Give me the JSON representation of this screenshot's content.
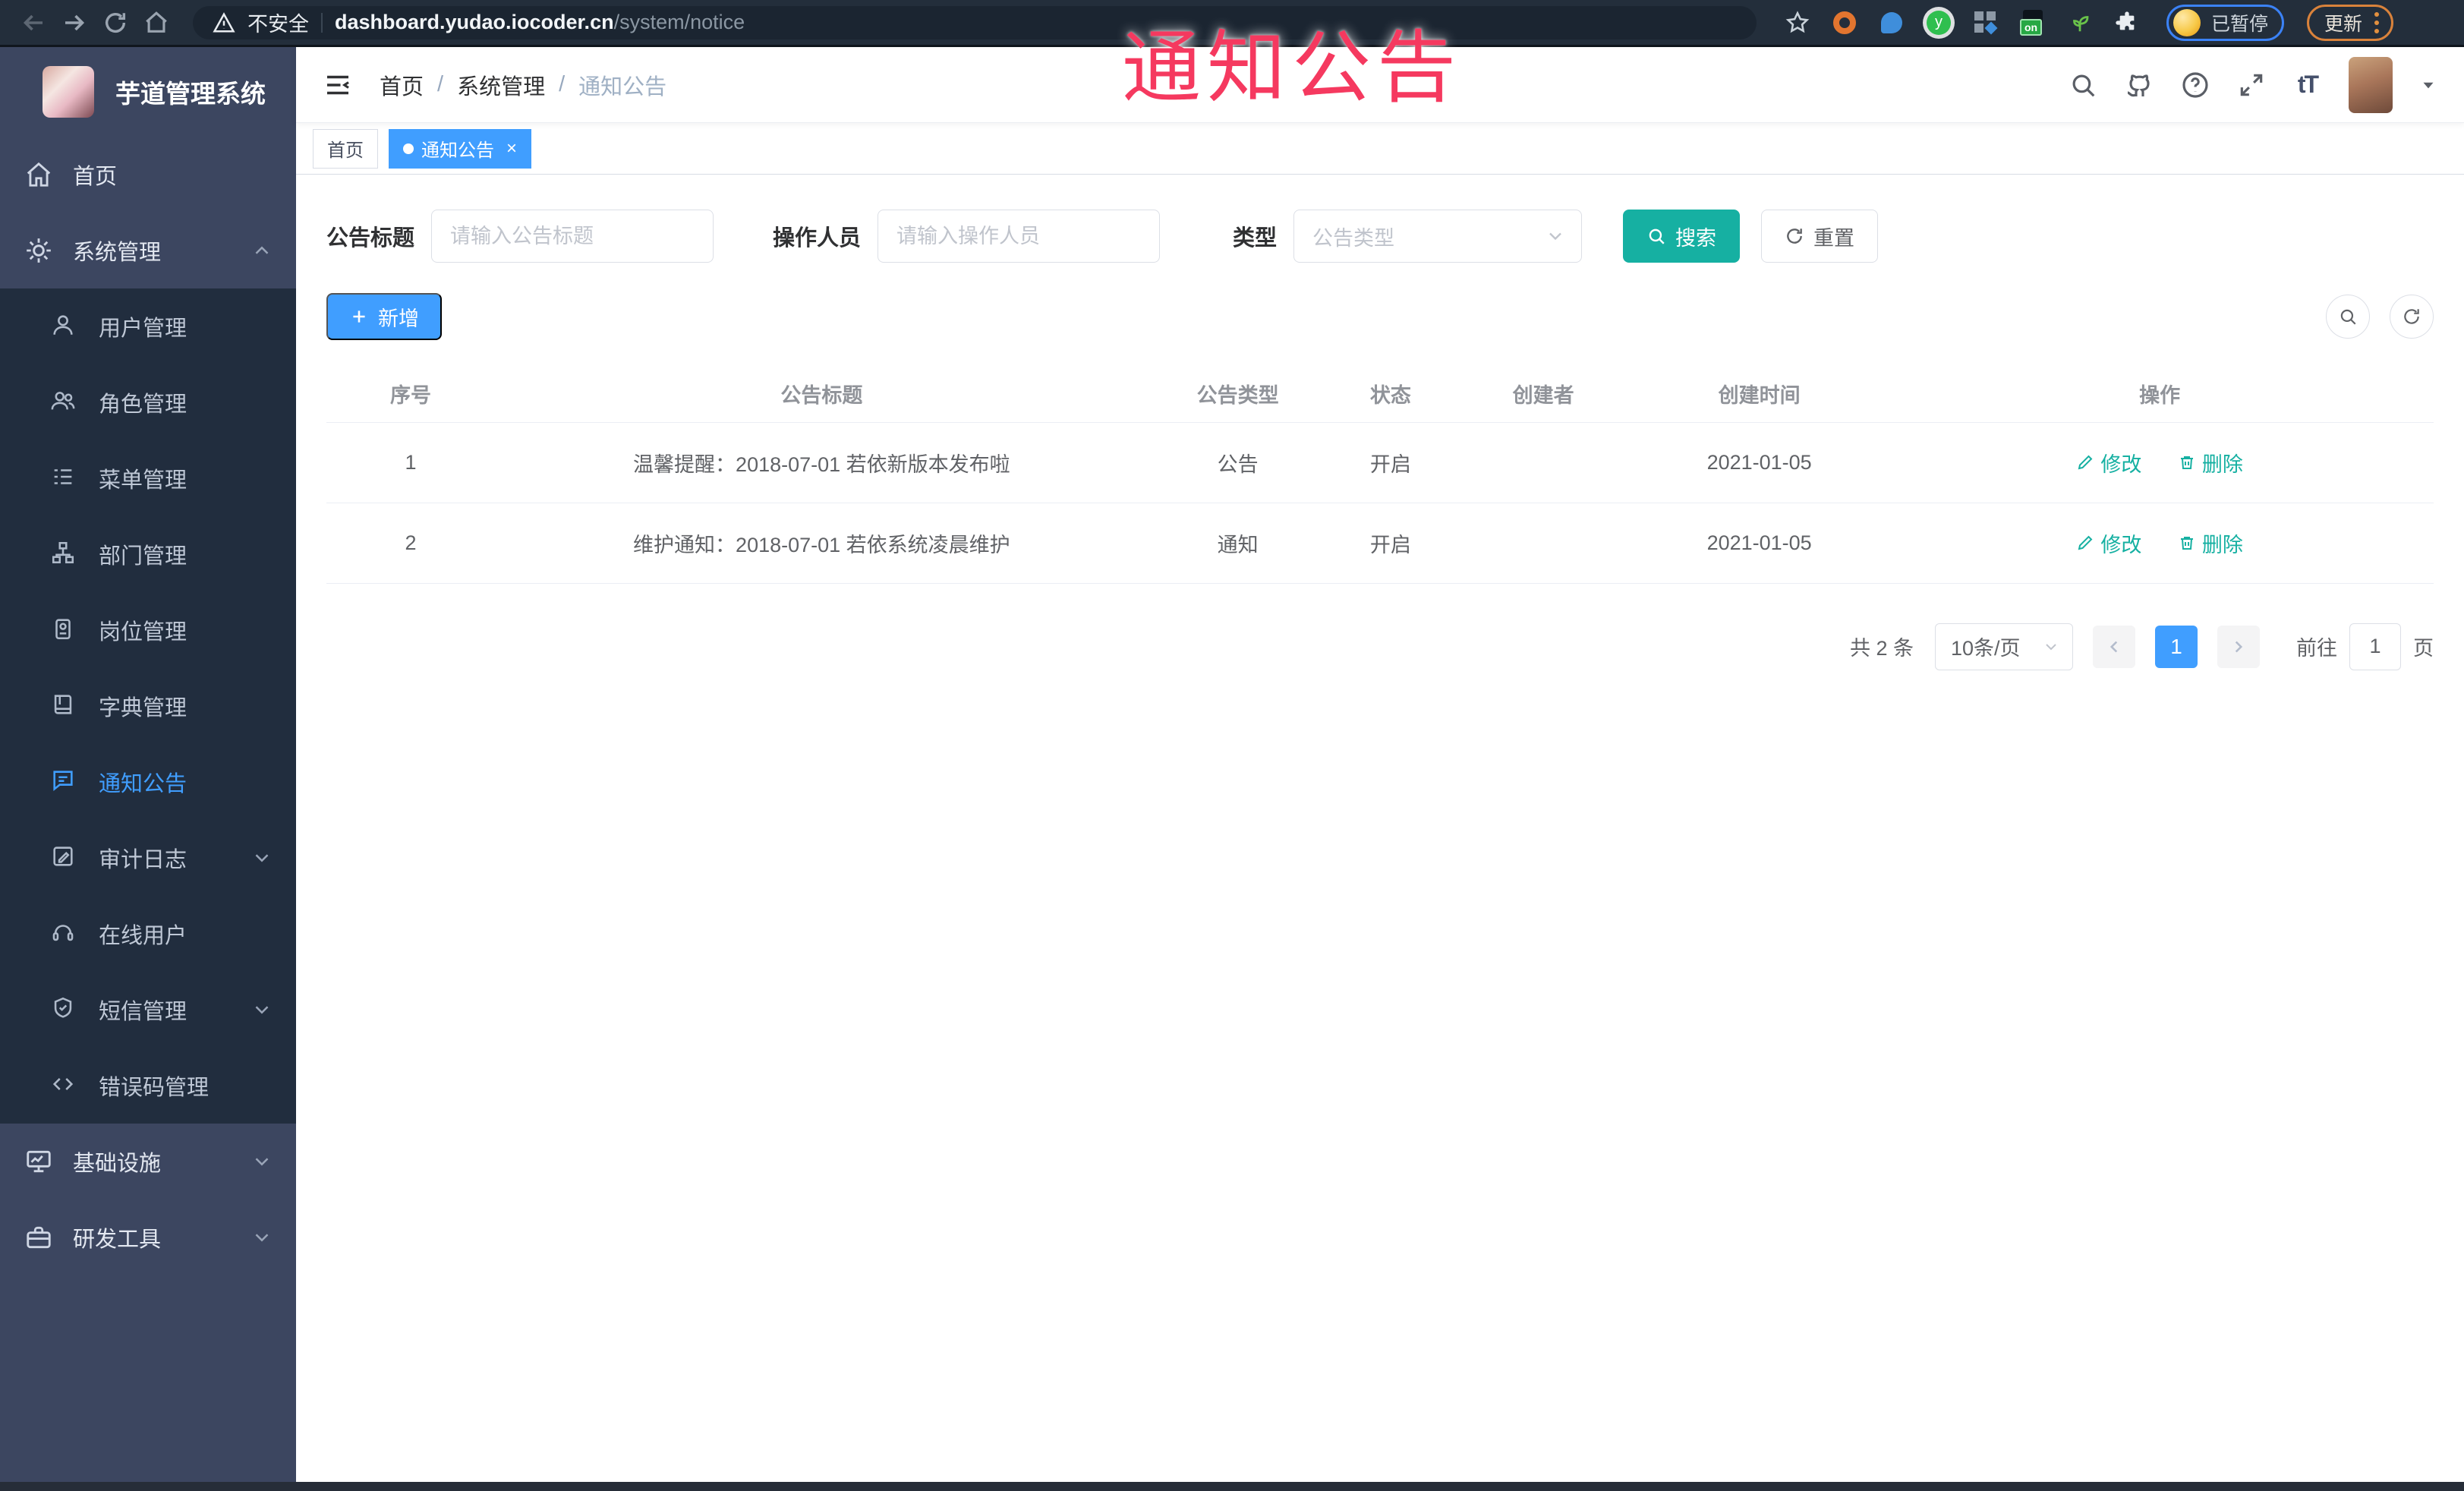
{
  "browser": {
    "security_label": "不安全",
    "url_domain": "dashboard.yudao.iocoder.cn",
    "url_path": "/system/notice",
    "profile_label": "已暂停",
    "update_label": "更新"
  },
  "annotation": {
    "text": "通知公告",
    "color": "#f5395f"
  },
  "sidebar": {
    "logo_title": "芋道管理系统",
    "items": [
      {
        "label": "首页"
      },
      {
        "label": "系统管理"
      },
      {
        "label": "用户管理"
      },
      {
        "label": "角色管理"
      },
      {
        "label": "菜单管理"
      },
      {
        "label": "部门管理"
      },
      {
        "label": "岗位管理"
      },
      {
        "label": "字典管理"
      },
      {
        "label": "通知公告"
      },
      {
        "label": "审计日志"
      },
      {
        "label": "在线用户"
      },
      {
        "label": "短信管理"
      },
      {
        "label": "错误码管理"
      },
      {
        "label": "基础设施"
      },
      {
        "label": "研发工具"
      }
    ]
  },
  "header": {
    "breadcrumbs": {
      "home": "首页",
      "system": "系统管理",
      "current": "通知公告"
    },
    "font_icon": "tT"
  },
  "tags": {
    "home": "首页",
    "current": "通知公告"
  },
  "filters": {
    "title_label": "公告标题",
    "title_placeholder": "请输入公告标题",
    "operator_label": "操作人员",
    "operator_placeholder": "请输入操作人员",
    "type_label": "类型",
    "type_placeholder": "公告类型",
    "search_label": "搜索",
    "reset_label": "重置"
  },
  "toolbar": {
    "add_label": "新增"
  },
  "table": {
    "columns": {
      "index": "序号",
      "title": "公告标题",
      "type": "公告类型",
      "status": "状态",
      "creator": "创建者",
      "created": "创建时间",
      "actions": "操作"
    },
    "rows": [
      {
        "index": "1",
        "title": "温馨提醒：2018-07-01 若依新版本发布啦",
        "type": "公告",
        "status": "开启",
        "creator": "",
        "created": "2021-01-05",
        "edit": "修改",
        "delete": "删除"
      },
      {
        "index": "2",
        "title": "维护通知：2018-07-01 若依系统凌晨维护",
        "type": "通知",
        "status": "开启",
        "creator": "",
        "created": "2021-01-05",
        "edit": "修改",
        "delete": "删除"
      }
    ]
  },
  "pagination": {
    "total": "共 2 条",
    "page_size": "10条/页",
    "current_page": "1",
    "goto_label": "前往",
    "goto_value": "1",
    "page_label": "页"
  },
  "colors": {
    "accent_blue": "#409eff",
    "accent_teal": "#16b0a2",
    "annotation_red": "#f5395f",
    "sidebar_bg": "#3c4660",
    "sidebar_submenu_bg": "#212d3e",
    "browser_bar_bg": "#232e3b"
  }
}
